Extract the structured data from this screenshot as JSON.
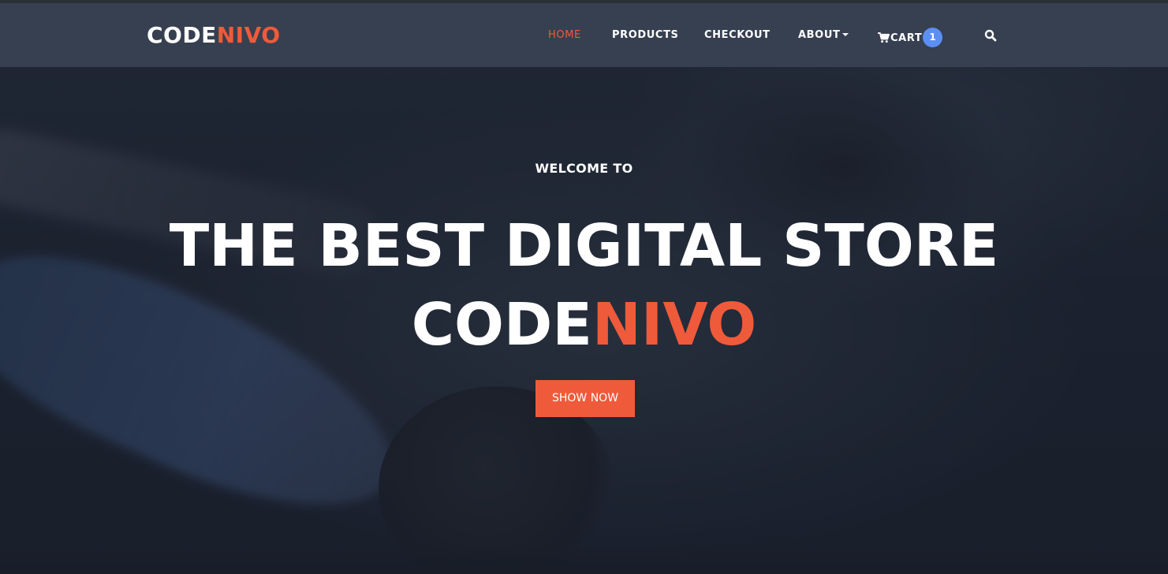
{
  "brand": {
    "logo_main": "CODE",
    "logo_accent": "NIVO"
  },
  "nav": {
    "items": [
      {
        "label": "HOME",
        "active": true
      },
      {
        "label": "PRODUCTS"
      },
      {
        "label": "CHECKOUT"
      },
      {
        "label": "ABOUT"
      }
    ],
    "cart_label": "CART",
    "cart_count": "1"
  },
  "hero": {
    "welcome": "WELCOME TO",
    "headline_line1": "THE BEST DIGITAL STORE",
    "headline_line2_main": "CODE",
    "headline_line2_accent": "NIVO",
    "cta_label": "SHOW NOW"
  },
  "icons": {
    "cart": "shopping-cart-icon",
    "search": "search-icon",
    "dropdown": "caret-down-icon"
  },
  "colors": {
    "accent": "#ef5a3b",
    "badge": "#5b8ff2",
    "navbar": "#3a4252",
    "background": "#1c2230"
  }
}
